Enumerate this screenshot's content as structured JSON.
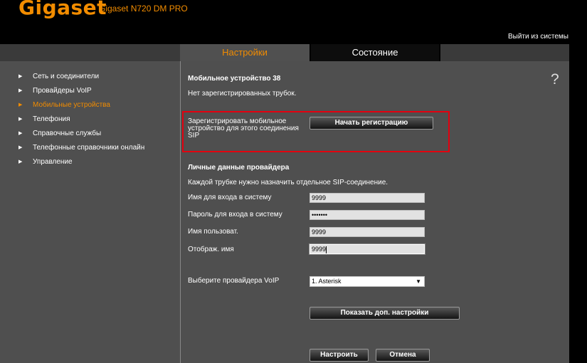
{
  "header": {
    "brand": "Gigaset",
    "model": "Gigaset N720 DM PRO",
    "logout": "Выйти из системы"
  },
  "tabs": {
    "settings": "Настройки",
    "status": "Состояние"
  },
  "sidebar": {
    "items": [
      {
        "label": "Сеть и соединители",
        "active": false
      },
      {
        "label": "Провайдеры VoIP",
        "active": false
      },
      {
        "label": "Мобильные устройства",
        "active": true
      },
      {
        "label": "Телефония",
        "active": false
      },
      {
        "label": "Справочные службы",
        "active": false
      },
      {
        "label": "Телефонные справочники онлайн",
        "active": false
      },
      {
        "label": "Управление",
        "active": false
      }
    ]
  },
  "main": {
    "title": "Мобильное устройство 38",
    "no_handsets": "Нет зарегистрированных трубок.",
    "help": "?",
    "register": {
      "label": "Зарегистрировать мобильное устройство для этого соединения SIP",
      "button": "Начать регистрацию"
    },
    "provider_section": {
      "title": "Личные данные провайдера",
      "hint": "Каждой трубке нужно назначить отдельное SIP-соединение.",
      "fields": {
        "login_label": "Имя для входа в систему",
        "login_value": "9999",
        "password_label": "Пароль для входа в систему",
        "password_value": "•••••••",
        "username_label": "Имя пользоват.",
        "username_value": "9999",
        "display_label": "Отображ. имя",
        "display_value": "9999"
      }
    },
    "voip": {
      "label": "Выберите провайдера VoIP",
      "selected": "1. Asterisk",
      "chevron": "▼"
    },
    "buttons": {
      "advanced": "Показать доп. настройки",
      "configure": "Настроить",
      "cancel": "Отмена"
    }
  },
  "colors": {
    "brand": "#f28c00",
    "panel": "#4f4f4f",
    "highlight": "#e3000f"
  }
}
